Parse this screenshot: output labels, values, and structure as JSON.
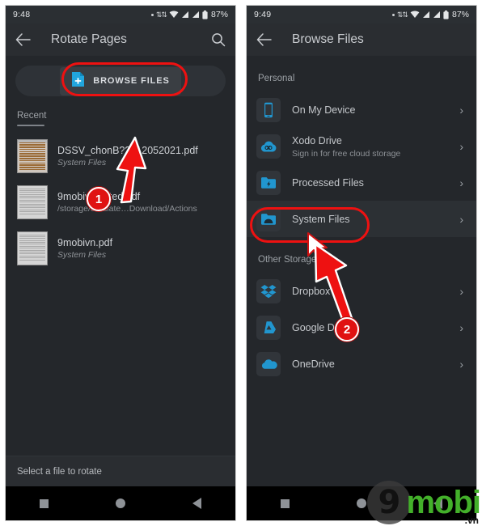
{
  "left": {
    "statusbar": {
      "clock": "9:48",
      "battery": "87%"
    },
    "appbar": {
      "title": "Rotate Pages",
      "back_icon": "back-arrow-icon",
      "search_icon": "search-icon"
    },
    "browse_button": {
      "label": "BROWSE FILES",
      "icon": "file-add-icon"
    },
    "tab": {
      "label": "Recent"
    },
    "files": [
      {
        "name": "DSSV_chonB??_12052021.pdf",
        "sub": "System Files",
        "sub_type": "source"
      },
      {
        "name": "9mobivn...cted.pdf",
        "sub": "/storage/emulate…Download/Actions",
        "sub_type": "path"
      },
      {
        "name": "9mobivn.pdf",
        "sub": "System Files",
        "sub_type": "source"
      }
    ],
    "bottom_hint": "Select a file to rotate",
    "navbar": {
      "recents": "square-icon",
      "home": "circle-icon",
      "back": "triangle-back-icon"
    }
  },
  "right": {
    "statusbar": {
      "clock": "9:49",
      "battery": "87%"
    },
    "appbar": {
      "title": "Browse Files",
      "back_icon": "back-arrow-icon"
    },
    "sections": [
      {
        "label": "Personal",
        "rows": [
          {
            "title": "On My Device",
            "sub": "",
            "icon": "phone-icon"
          },
          {
            "title": "Xodo Drive",
            "sub": "Sign in for free cloud storage",
            "icon": "cloud-xodo-icon"
          },
          {
            "title": "Processed Files",
            "sub": "",
            "icon": "folder-bolt-icon"
          },
          {
            "title": "System Files",
            "sub": "",
            "icon": "folder-system-icon",
            "highlighted": true
          }
        ]
      },
      {
        "label": "Other Storage",
        "rows": [
          {
            "title": "Dropbox",
            "sub": "",
            "icon": "dropbox-icon"
          },
          {
            "title": "Google Drive",
            "sub": "",
            "icon": "google-drive-icon"
          },
          {
            "title": "OneDrive",
            "sub": "",
            "icon": "onedrive-icon"
          }
        ]
      }
    ],
    "navbar": {
      "recents": "square-icon",
      "home": "circle-icon",
      "back": "triangle-back-icon"
    }
  },
  "annotations": {
    "step1": "1",
    "step2": "2"
  },
  "watermark": {
    "digit": "9",
    "name": "mobi",
    "tld": ".vn"
  },
  "colors": {
    "accent_blue": "#2196cf",
    "annotation_red": "#ee1111",
    "background": "#24272b",
    "appbar": "#2a2d31",
    "watermark_green": "#43b02a"
  }
}
